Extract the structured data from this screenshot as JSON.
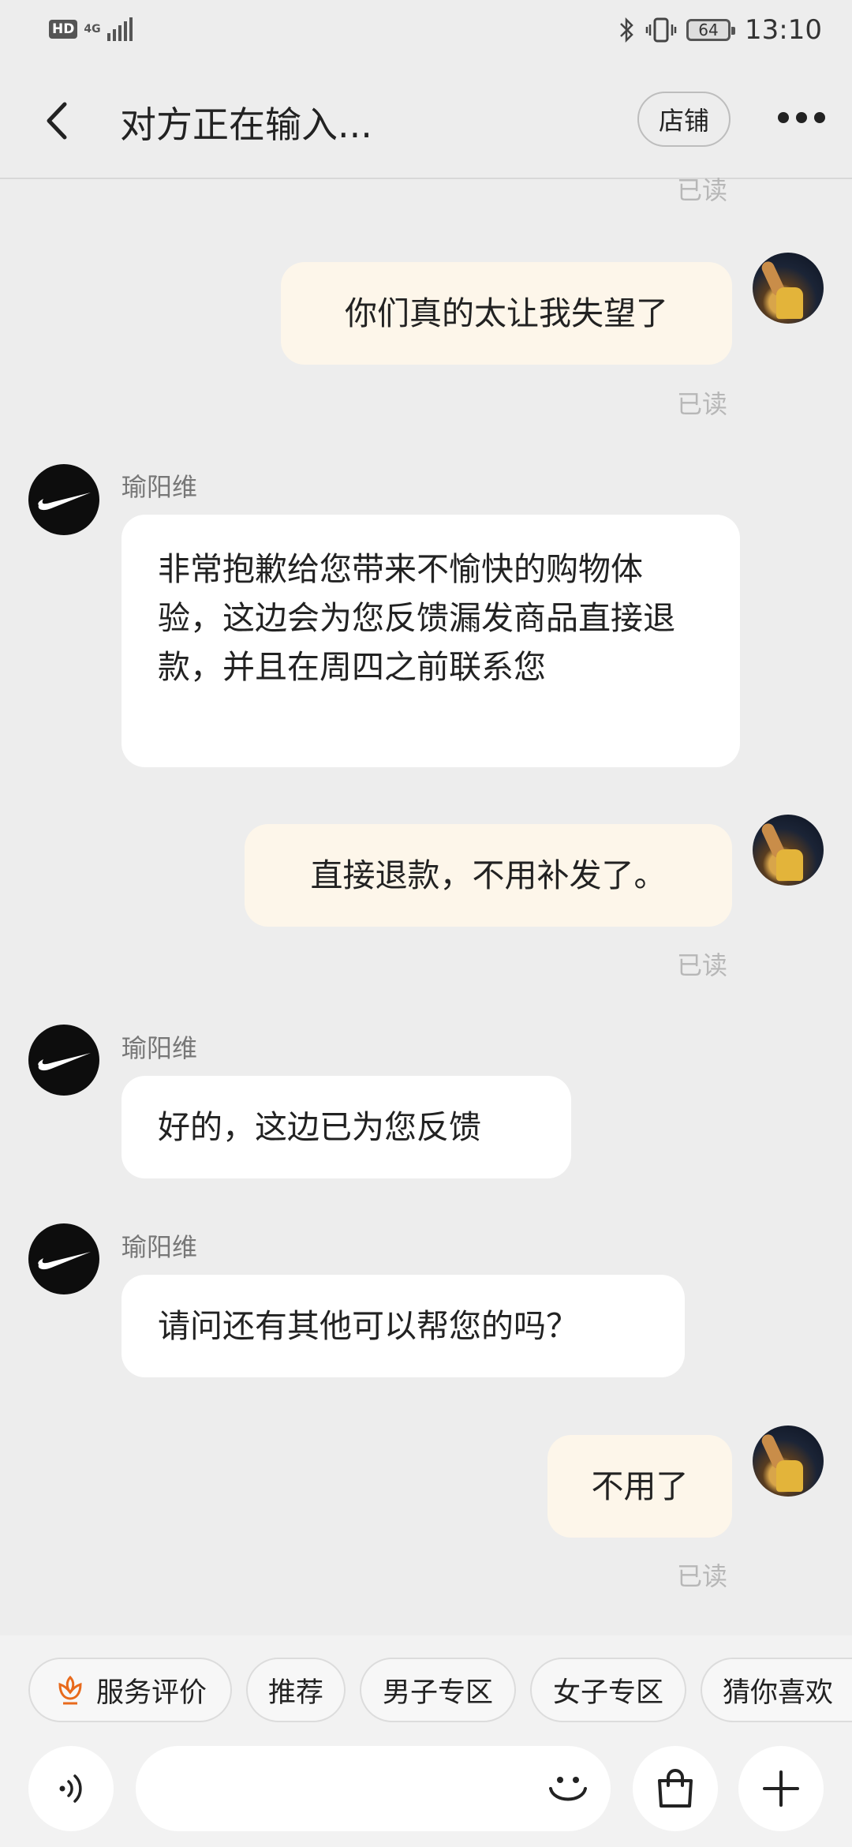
{
  "status_bar": {
    "hd": "HD",
    "network": "4G",
    "battery": "64",
    "time": "13:10"
  },
  "header": {
    "title": "对方正在输入...",
    "shop_button": "店铺"
  },
  "messages": {
    "read_top": "已读",
    "m1": {
      "text": "你们真的太让我失望了",
      "status": "已读"
    },
    "m2": {
      "sender": "瑜阳维",
      "text": "非常抱歉给您带来不愉快的购物体验，这边会为您反馈漏发商品直接退款，并且在周四之前联系您"
    },
    "m3": {
      "text": "直接退款，不用补发了。",
      "status": "已读"
    },
    "m4": {
      "sender": "瑜阳维",
      "text": "好的，这边已为您反馈"
    },
    "m5": {
      "sender": "瑜阳维",
      "text": "请问还有其他可以帮您的吗？"
    },
    "m6": {
      "text": "不用了",
      "status": "已读"
    }
  },
  "quick_replies": [
    "服务评价",
    "推荐",
    "男子专区",
    "女子专区",
    "猜你喜欢"
  ],
  "input": {
    "voice_icon": "voice-icon",
    "emoji_icon": "emoji-icon",
    "bag_icon": "shopping-bag-icon",
    "plus_icon": "plus-icon"
  }
}
